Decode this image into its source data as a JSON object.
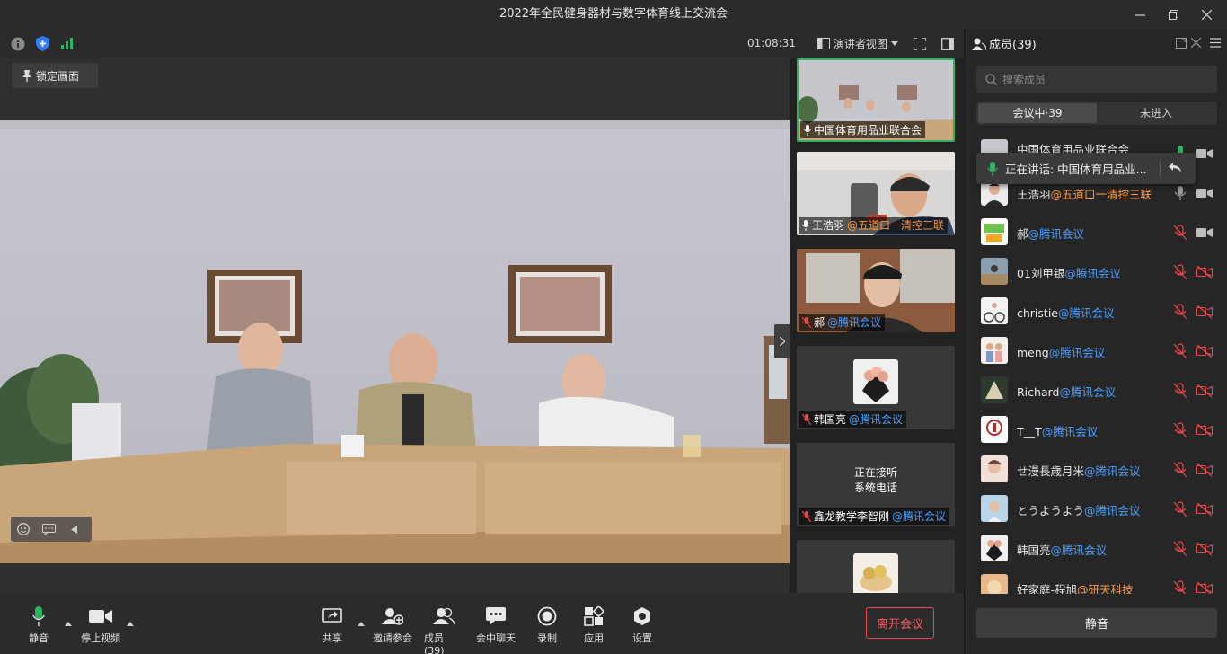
{
  "window": {
    "title": "2022年全民健身器材与数字体育线上交流会"
  },
  "topbar": {
    "timer": "01:08:31",
    "layout_label": "演讲者视图"
  },
  "stage": {
    "lock_label": "锁定画面"
  },
  "thumbnails": [
    {
      "name": "中国体育用品业联合会",
      "org": "",
      "mic": "on",
      "active": true
    },
    {
      "name": "王浩羽",
      "org": "@五道口一清控三联",
      "org_color": "orange",
      "mic": "on"
    },
    {
      "name": "郝",
      "org": "@腾讯会议",
      "mic": "off"
    },
    {
      "name": "韩国亮",
      "org": "@腾讯会议",
      "mic": "off"
    },
    {
      "name": "鑫龙教学李智刚",
      "org": "@腾讯会议",
      "mic": "off",
      "status": "正在接听\n系统电话"
    },
    {
      "name": "",
      "org": "",
      "mic": "off"
    }
  ],
  "calling_line1": "正在接听",
  "calling_line2": "系统电话",
  "toolbar": {
    "mute_label": "静音",
    "video_label": "停止视频",
    "share_label": "共享",
    "invite_label": "邀请参会",
    "members_label": "成员(39)",
    "chat_label": "会中聊天",
    "record_label": "录制",
    "apps_label": "应用",
    "settings_label": "设置",
    "leave_label": "离开会议"
  },
  "panel": {
    "title": "成员(39)",
    "search_placeholder": "搜索成员",
    "tab_in": "会议中·39",
    "tab_out": "未进入",
    "speaking": "正在讲话: 中国体育用品业...",
    "mute_all": "静音",
    "members": [
      {
        "name": "中国体育用品业联合会",
        "org": ""
      },
      {
        "name": "王浩羽",
        "org": "@五道口一清控三联",
        "org_color": "orange"
      },
      {
        "name": "郝",
        "org": "@腾讯会议"
      },
      {
        "name": "01刘甲银",
        "org": "@腾讯会议"
      },
      {
        "name": "christie",
        "org": "@腾讯会议"
      },
      {
        "name": "meng",
        "org": "@腾讯会议"
      },
      {
        "name": "Richard",
        "org": "@腾讯会议"
      },
      {
        "name": "T__T",
        "org": "@腾讯会议"
      },
      {
        "name": "せ漫長歳月米",
        "org": "@腾讯会议"
      },
      {
        "name": "とうようよう",
        "org": "@腾讯会议"
      },
      {
        "name": "韩国亮",
        "org": "@腾讯会议"
      },
      {
        "name": "好家庭-程旭",
        "org": "@研天科技",
        "org_color": "orange"
      }
    ]
  },
  "colors": {
    "accent_green": "#2fb35e",
    "link_blue": "#4a9eff",
    "org_orange": "#ff9a3c",
    "leave_red": "#e5484d"
  }
}
